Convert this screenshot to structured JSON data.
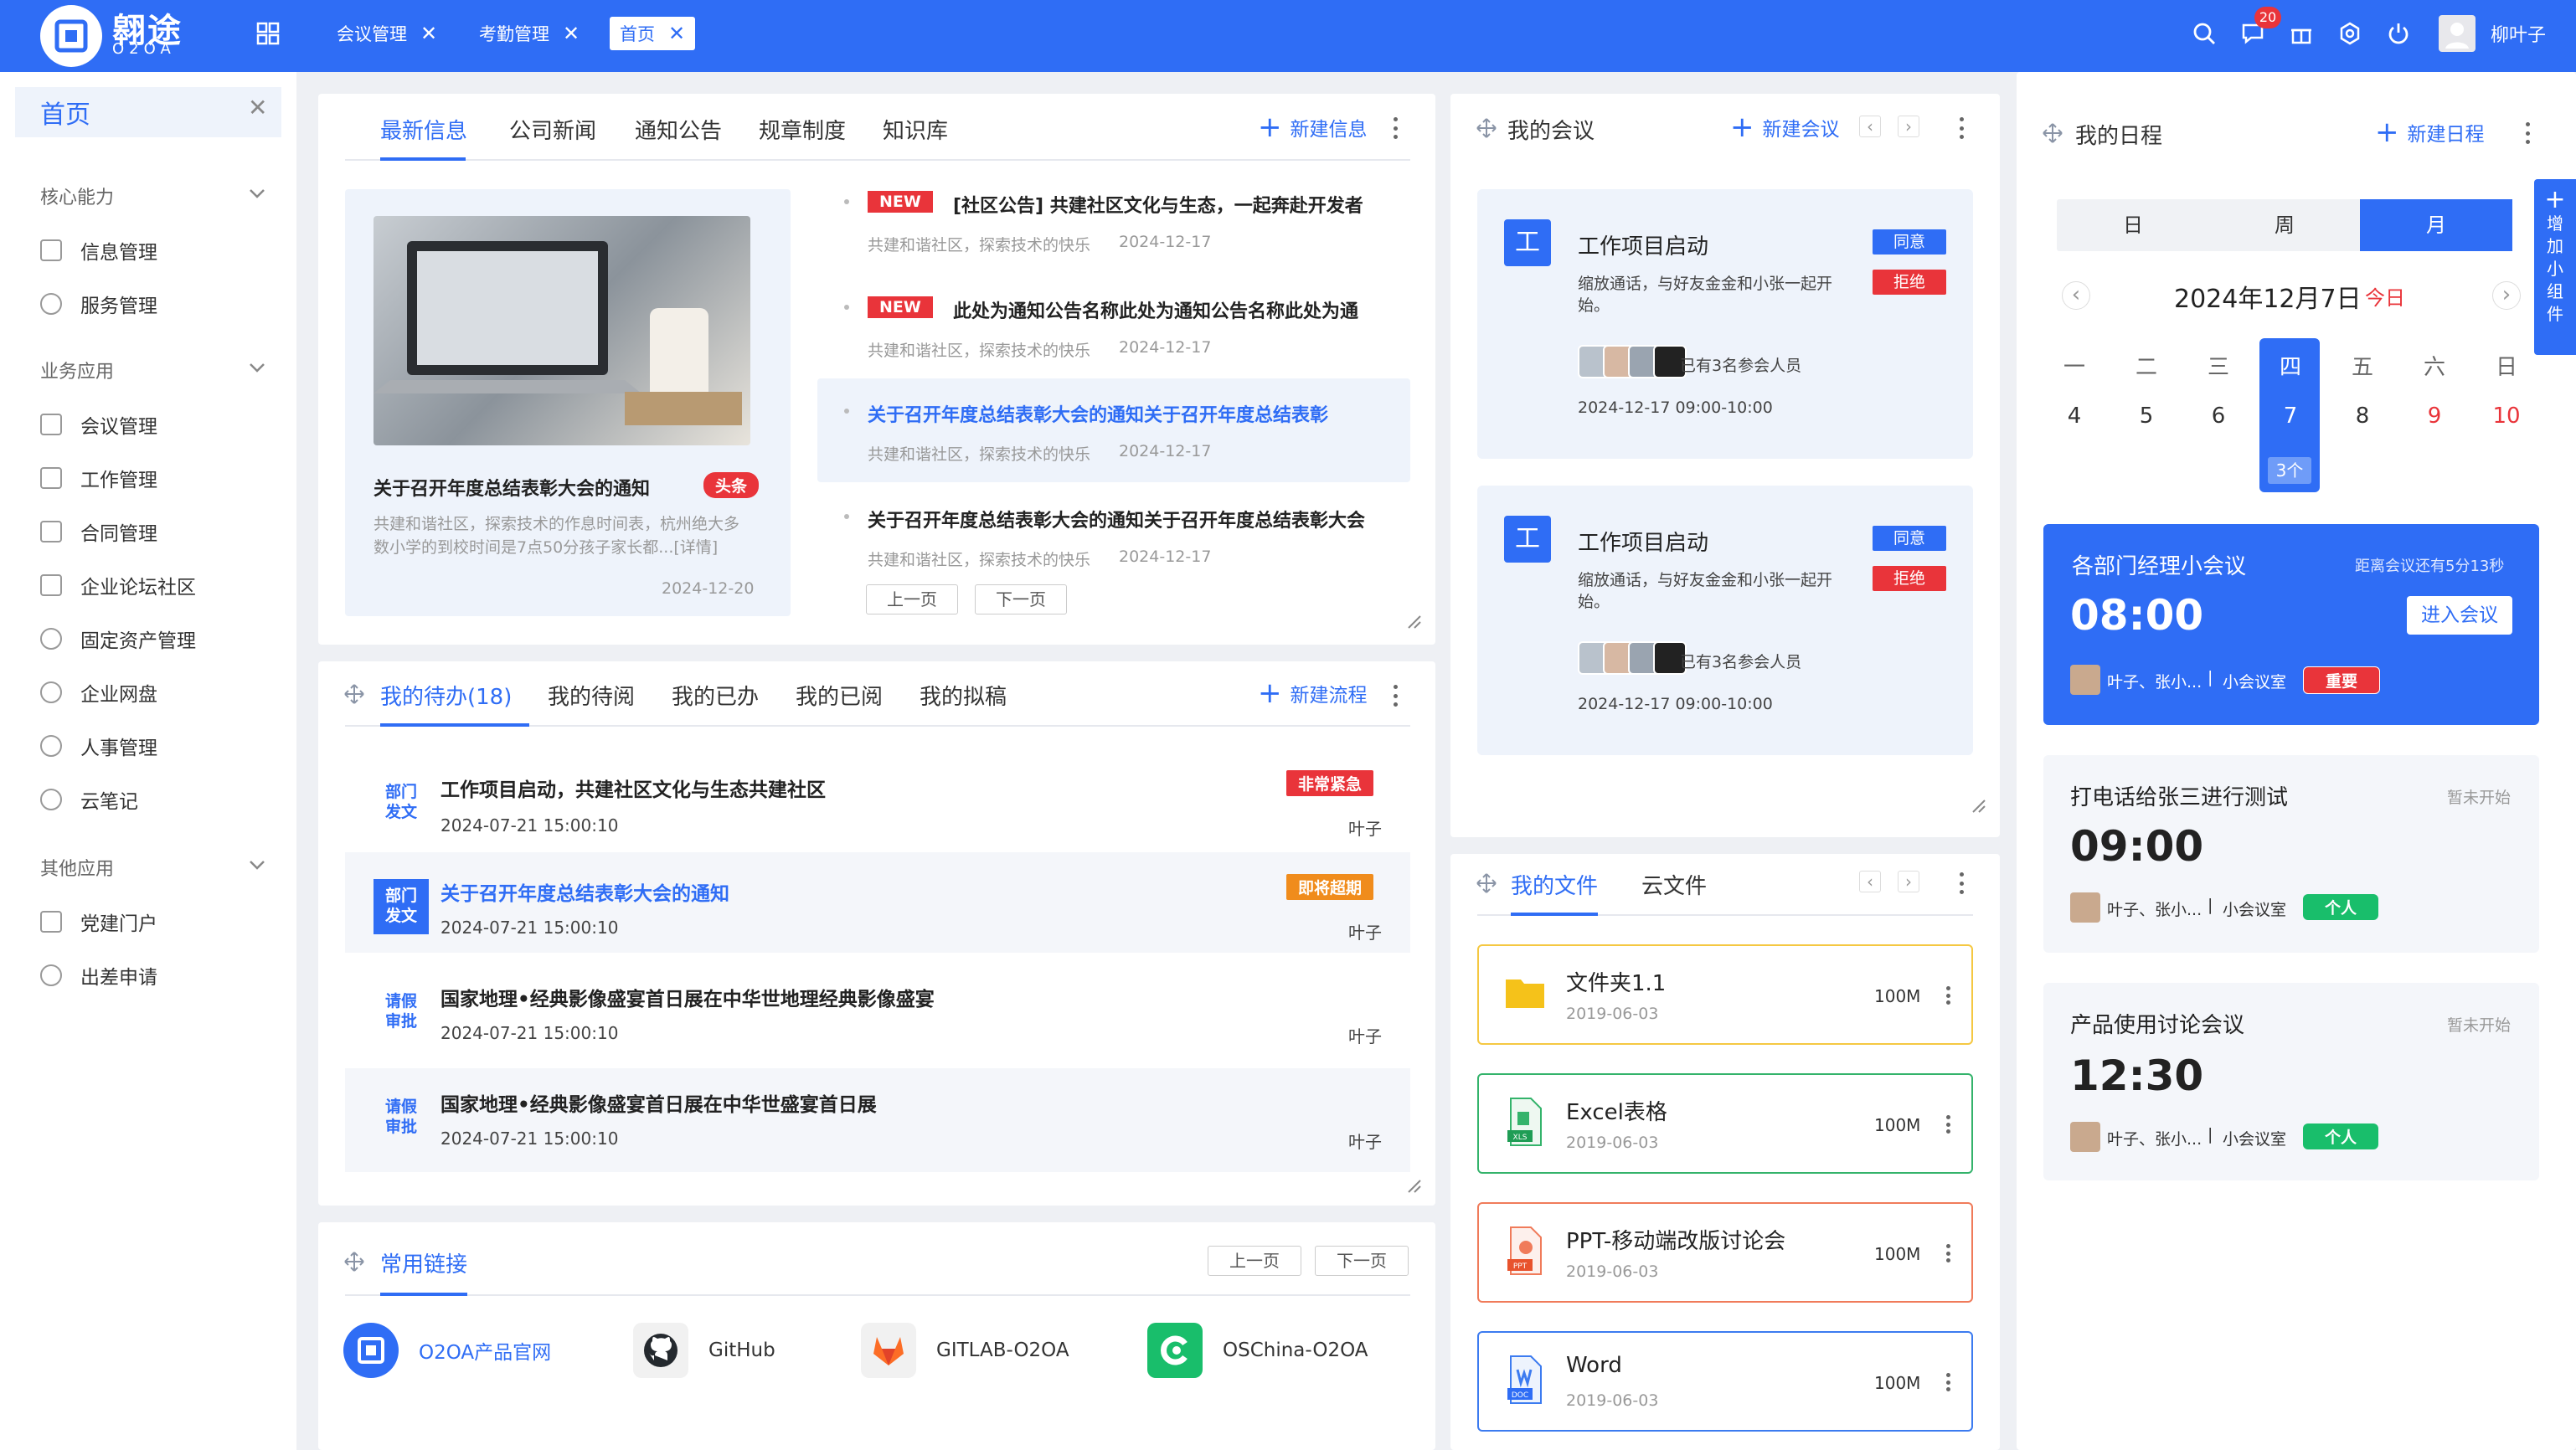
{
  "topbar": {
    "logo_text": "翱途",
    "logo_sub": "O2OA",
    "tabs": [
      {
        "label": "会议管理"
      },
      {
        "label": "考勤管理"
      },
      {
        "label": "首页"
      }
    ],
    "notification_count": "20",
    "username": "柳叶子"
  },
  "sidebar": {
    "home": "首页",
    "groups": [
      {
        "label": "核心能力",
        "items": [
          "信息管理",
          "服务管理"
        ]
      },
      {
        "label": "业务应用",
        "items": [
          "会议管理",
          "工作管理",
          "合同管理",
          "企业论坛社区",
          "固定资产管理",
          "企业网盘",
          "人事管理",
          "云笔记"
        ]
      },
      {
        "label": "其他应用",
        "items": [
          "党建门户",
          "出差申请"
        ]
      }
    ]
  },
  "news": {
    "tabs": [
      "最新信息",
      "公司新闻",
      "通知公告",
      "规章制度",
      "知识库"
    ],
    "new_button": "新建信息",
    "featured": {
      "title": "关于召开年度总结表彰大会的通知",
      "tag": "头条",
      "desc": "共建和谐社区，探索技术的作息时间表，杭州绝大多数小学的到校时间是7点50分孩子家长都...[详情]",
      "date": "2024-12-20"
    },
    "items": [
      {
        "new": "NEW",
        "title": "[社区公告] 共建社区文化与生态，一起奔赴开发者",
        "meta": "共建和谐社区，探索技术的快乐",
        "date": "2024-12-17"
      },
      {
        "new": "NEW",
        "title": "此处为通知公告名称此处为通知公告名称此处为通",
        "meta": "共建和谐社区，探索技术的快乐",
        "date": "2024-12-17"
      },
      {
        "new": "",
        "title": "关于召开年度总结表彰大会的通知关于召开年度总结表彰",
        "meta": "共建和谐社区，探索技术的快乐",
        "date": "2024-12-17"
      },
      {
        "new": "",
        "title": "关于召开年度总结表彰大会的通知关于召开年度总结表彰大会",
        "meta": "共建和谐社区，探索技术的快乐",
        "date": "2024-12-17"
      }
    ],
    "prev": "上一页",
    "next": "下一页"
  },
  "todo": {
    "tabs": [
      "我的待办(18)",
      "我的待阅",
      "我的已办",
      "我的已阅",
      "我的拟稿"
    ],
    "new_button": "新建流程",
    "items": [
      {
        "tag": "部门\n发文",
        "title": "工作项目启动，共建社区文化与生态共建社区",
        "date": "2024-07-21  15:00:10",
        "user": "叶子",
        "status": "非常紧急"
      },
      {
        "tag": "部门\n发文",
        "title": "关于召开年度总结表彰大会的通知",
        "date": "2024-07-21  15:00:10",
        "user": "叶子",
        "status": "即将超期"
      },
      {
        "tag": "请假\n审批",
        "title": "国家地理•经典影像盛宴首日展在中华世地理经典影像盛宴",
        "date": "2024-07-21  15:00:10",
        "user": "叶子",
        "status": ""
      },
      {
        "tag": "请假\n审批",
        "title": "国家地理•经典影像盛宴首日展在中华世盛宴首日展",
        "date": "2024-07-21  15:00:10",
        "user": "叶子",
        "status": ""
      }
    ],
    "colors": {
      "urgent": "#e9343a",
      "overdue": "#f08c1c"
    }
  },
  "links": {
    "title": "常用链接",
    "prev": "上一页",
    "next": "下一页",
    "items": [
      {
        "label": "O2OA产品官网",
        "icon": "o2oa-logo-icon"
      },
      {
        "label": "GitHub",
        "icon": "github-icon"
      },
      {
        "label": "GITLAB-O2OA",
        "icon": "gitlab-icon"
      },
      {
        "label": "OSChina-O2OA",
        "icon": "oschina-icon"
      }
    ]
  },
  "meetings": {
    "title": "我的会议",
    "new_button": "新建会议",
    "items": [
      {
        "icon": "工",
        "title": "工作项目启动",
        "desc": "缩放通话，与好友金金和小张一起开始。",
        "accept": "同意",
        "reject": "拒绝",
        "attendees": "已有3名参会人员",
        "time": "2024-12-17 09:00-10:00"
      },
      {
        "icon": "工",
        "title": "工作项目启动",
        "desc": "缩放通话，与好友金金和小张一起开始。",
        "accept": "同意",
        "reject": "拒绝",
        "attendees": "已有3名参会人员",
        "time": "2024-12-17 09:00-10:00"
      }
    ]
  },
  "files": {
    "tabs": [
      "我的文件",
      "云文件"
    ],
    "items": [
      {
        "name": "文件夹1.1",
        "date": "2019-06-03",
        "size": "100M",
        "icon": "folder-icon",
        "border": "#f5c842"
      },
      {
        "name": "Excel表格",
        "date": "2019-06-03",
        "size": "100M",
        "icon": "excel-icon",
        "border": "#34b36b"
      },
      {
        "name": "PPT-移动端改版讨论会",
        "date": "2019-06-03",
        "size": "100M",
        "icon": "ppt-icon",
        "border": "#f07b5a"
      },
      {
        "name": "Word",
        "date": "2019-06-03",
        "size": "100M",
        "icon": "word-icon",
        "border": "#3c7bf0"
      }
    ]
  },
  "schedule": {
    "title": "我的日程",
    "new_button": "新建日程",
    "view_tabs": [
      "日",
      "周",
      "月"
    ],
    "date_label": "2024年12月7日",
    "today": "今日",
    "weekdays": [
      "一",
      "二",
      "三",
      "四",
      "五",
      "六",
      "日"
    ],
    "days": [
      "4",
      "5",
      "6",
      "7",
      "8",
      "9",
      "10"
    ],
    "selected_count": "3个",
    "side_widget": "增加小组件",
    "events": [
      {
        "title": "各部门经理小会议",
        "countdown": "距离会议还有5分13秒",
        "time": "08:00",
        "action": "进入会议",
        "people": "叶子、张小...",
        "room": "小会议室",
        "tag": "重要"
      },
      {
        "title": "打电话给张三进行测试",
        "countdown": "暂未开始",
        "time": "09:00",
        "people": "叶子、张小...",
        "room": "小会议室",
        "tag": "个人"
      },
      {
        "title": "产品使用讨论会议",
        "countdown": "暂未开始",
        "time": "12:30",
        "people": "叶子、张小...",
        "room": "小会议室",
        "tag": "个人"
      }
    ]
  },
  "colors": {
    "primary": "#2f6df5",
    "danger": "#e9343a",
    "success": "#19be6b",
    "warning": "#f08c1c"
  }
}
